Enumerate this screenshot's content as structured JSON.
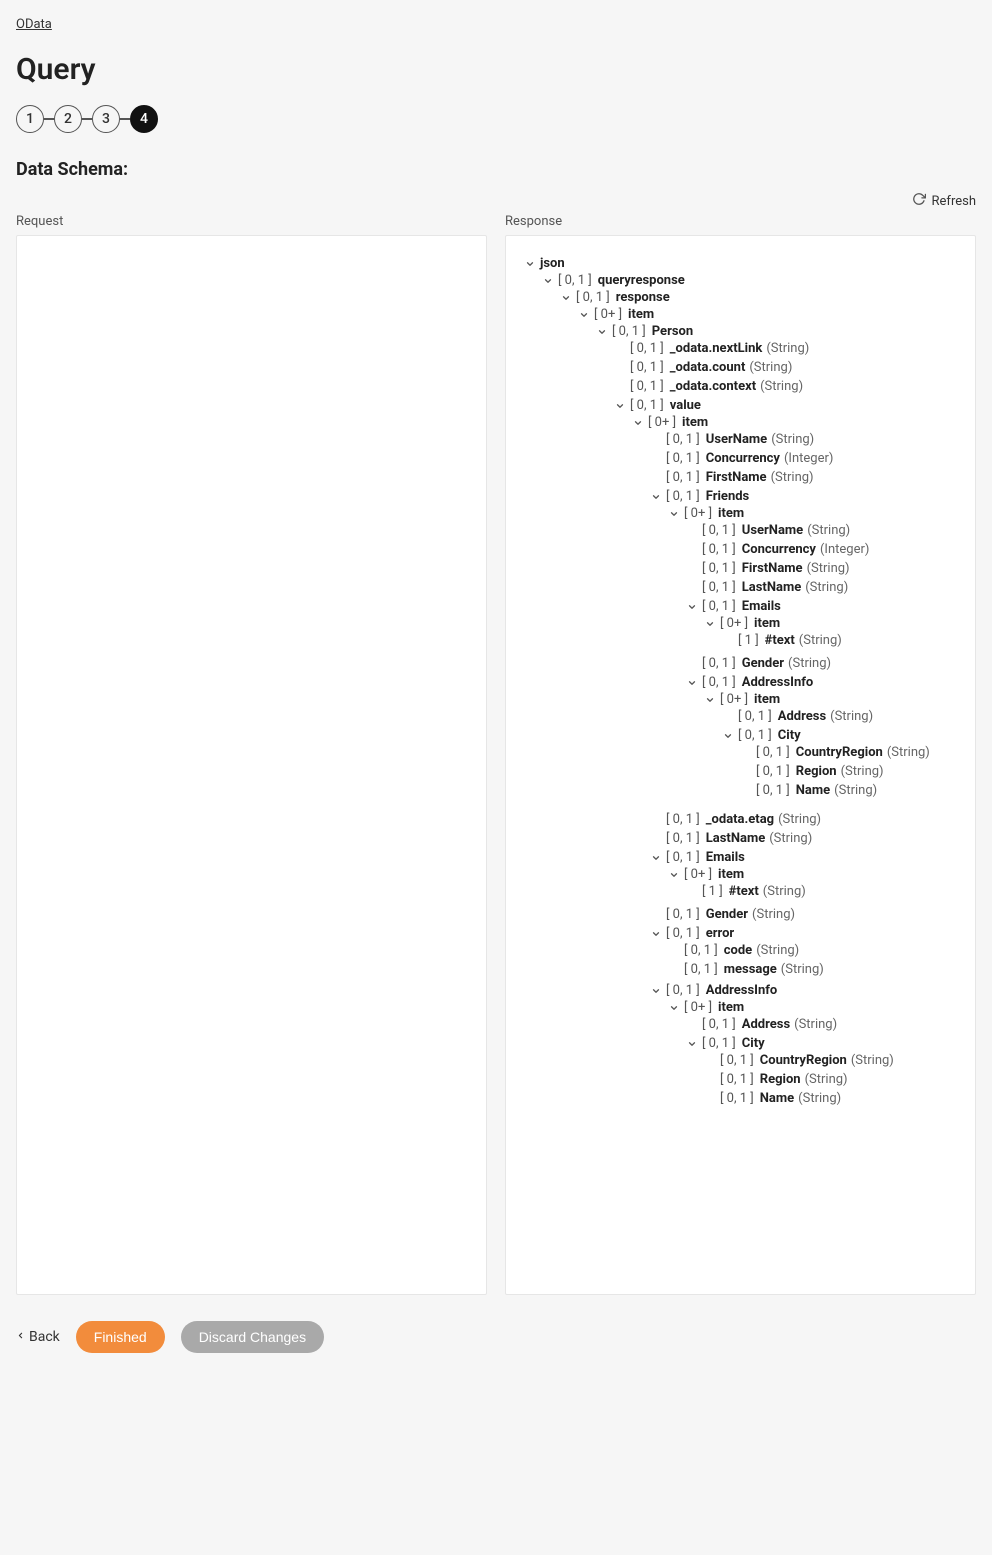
{
  "breadcrumb": "OData",
  "title": "Query",
  "wizard": {
    "steps": [
      "1",
      "2",
      "3",
      "4"
    ],
    "active": 3
  },
  "section": "Data Schema:",
  "labels": {
    "request": "Request",
    "response": "Response",
    "refresh": "Refresh"
  },
  "footer": {
    "back": "Back",
    "finished": "Finished",
    "discard": "Discard Changes"
  },
  "tree": [
    {
      "name": "json",
      "card": "",
      "children": [
        {
          "name": "queryresponse",
          "card": "[ 0, 1 ]",
          "children": [
            {
              "name": "response",
              "card": "[ 0, 1 ]",
              "children": [
                {
                  "name": "item",
                  "card": "[ 0+ ]",
                  "children": [
                    {
                      "name": "Person",
                      "card": "[ 0, 1 ]",
                      "children": [
                        {
                          "name": "_odata.nextLink",
                          "card": "[ 0, 1 ]",
                          "type": "(String)"
                        },
                        {
                          "name": "_odata.count",
                          "card": "[ 0, 1 ]",
                          "type": "(String)"
                        },
                        {
                          "name": "_odata.context",
                          "card": "[ 0, 1 ]",
                          "type": "(String)"
                        },
                        {
                          "name": "value",
                          "card": "[ 0, 1 ]",
                          "children": [
                            {
                              "name": "item",
                              "card": "[ 0+ ]",
                              "children": [
                                {
                                  "name": "UserName",
                                  "card": "[ 0, 1 ]",
                                  "type": "(String)"
                                },
                                {
                                  "name": "Concurrency",
                                  "card": "[ 0, 1 ]",
                                  "type": "(Integer)"
                                },
                                {
                                  "name": "FirstName",
                                  "card": "[ 0, 1 ]",
                                  "type": "(String)"
                                },
                                {
                                  "name": "Friends",
                                  "card": "[ 0, 1 ]",
                                  "children": [
                                    {
                                      "name": "item",
                                      "card": "[ 0+ ]",
                                      "children": [
                                        {
                                          "name": "UserName",
                                          "card": "[ 0, 1 ]",
                                          "type": "(String)"
                                        },
                                        {
                                          "name": "Concurrency",
                                          "card": "[ 0, 1 ]",
                                          "type": "(Integer)"
                                        },
                                        {
                                          "name": "FirstName",
                                          "card": "[ 0, 1 ]",
                                          "type": "(String)"
                                        },
                                        {
                                          "name": "LastName",
                                          "card": "[ 0, 1 ]",
                                          "type": "(String)"
                                        },
                                        {
                                          "name": "Emails",
                                          "card": "[ 0, 1 ]",
                                          "children": [
                                            {
                                              "name": "item",
                                              "card": "[ 0+ ]",
                                              "children": [
                                                {
                                                  "name": "#text",
                                                  "card": "[ 1 ]",
                                                  "type": "(String)"
                                                }
                                              ]
                                            }
                                          ]
                                        },
                                        {
                                          "name": "Gender",
                                          "card": "[ 0, 1 ]",
                                          "type": "(String)"
                                        },
                                        {
                                          "name": "AddressInfo",
                                          "card": "[ 0, 1 ]",
                                          "children": [
                                            {
                                              "name": "item",
                                              "card": "[ 0+ ]",
                                              "children": [
                                                {
                                                  "name": "Address",
                                                  "card": "[ 0, 1 ]",
                                                  "type": "(String)"
                                                },
                                                {
                                                  "name": "City",
                                                  "card": "[ 0, 1 ]",
                                                  "children": [
                                                    {
                                                      "name": "CountryRegion",
                                                      "card": "[ 0, 1 ]",
                                                      "type": "(String)"
                                                    },
                                                    {
                                                      "name": "Region",
                                                      "card": "[ 0, 1 ]",
                                                      "type": "(String)"
                                                    },
                                                    {
                                                      "name": "Name",
                                                      "card": "[ 0, 1 ]",
                                                      "type": "(String)"
                                                    }
                                                  ]
                                                }
                                              ]
                                            }
                                          ]
                                        }
                                      ]
                                    }
                                  ]
                                },
                                {
                                  "name": "_odata.etag",
                                  "card": "[ 0, 1 ]",
                                  "type": "(String)"
                                },
                                {
                                  "name": "LastName",
                                  "card": "[ 0, 1 ]",
                                  "type": "(String)"
                                },
                                {
                                  "name": "Emails",
                                  "card": "[ 0, 1 ]",
                                  "children": [
                                    {
                                      "name": "item",
                                      "card": "[ 0+ ]",
                                      "children": [
                                        {
                                          "name": "#text",
                                          "card": "[ 1 ]",
                                          "type": "(String)"
                                        }
                                      ]
                                    }
                                  ]
                                },
                                {
                                  "name": "Gender",
                                  "card": "[ 0, 1 ]",
                                  "type": "(String)"
                                },
                                {
                                  "name": "error",
                                  "card": "[ 0, 1 ]",
                                  "children": [
                                    {
                                      "name": "code",
                                      "card": "[ 0, 1 ]",
                                      "type": "(String)"
                                    },
                                    {
                                      "name": "message",
                                      "card": "[ 0, 1 ]",
                                      "type": "(String)"
                                    }
                                  ]
                                },
                                {
                                  "name": "AddressInfo",
                                  "card": "[ 0, 1 ]",
                                  "children": [
                                    {
                                      "name": "item",
                                      "card": "[ 0+ ]",
                                      "children": [
                                        {
                                          "name": "Address",
                                          "card": "[ 0, 1 ]",
                                          "type": "(String)"
                                        },
                                        {
                                          "name": "City",
                                          "card": "[ 0, 1 ]",
                                          "children": [
                                            {
                                              "name": "CountryRegion",
                                              "card": "[ 0, 1 ]",
                                              "type": "(String)"
                                            },
                                            {
                                              "name": "Region",
                                              "card": "[ 0, 1 ]",
                                              "type": "(String)"
                                            },
                                            {
                                              "name": "Name",
                                              "card": "[ 0, 1 ]",
                                              "type": "(String)"
                                            }
                                          ]
                                        }
                                      ]
                                    }
                                  ]
                                }
                              ]
                            }
                          ]
                        }
                      ]
                    }
                  ]
                }
              ]
            }
          ]
        }
      ]
    }
  ]
}
